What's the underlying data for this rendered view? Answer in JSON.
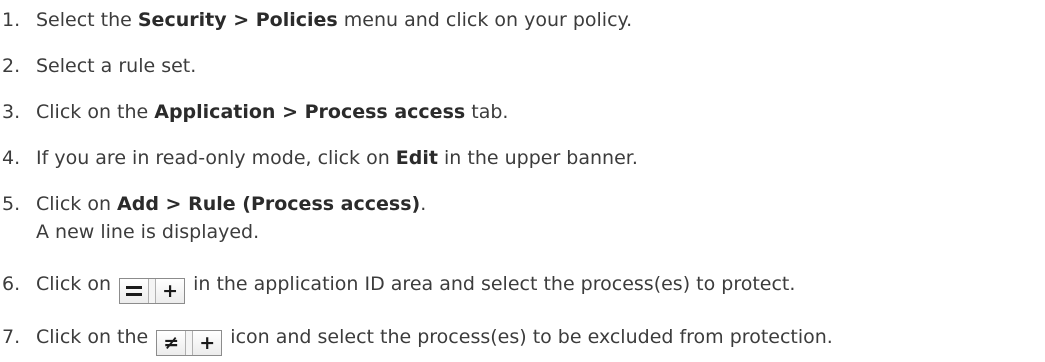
{
  "steps": [
    {
      "num": "1.",
      "pre": "Select the ",
      "b1": "Security",
      "mid": " > ",
      "b2": "Policies",
      "post": " menu and click on your policy."
    },
    {
      "num": "2.",
      "text": "Select a rule set."
    },
    {
      "num": "3.",
      "pre": "Click on the ",
      "b1": "Application",
      "mid": " > ",
      "b2": "Process access",
      "post": " tab."
    },
    {
      "num": "4.",
      "pre": "If you are in read-only mode, click on ",
      "b1": "Edit",
      "post": " in the upper banner."
    },
    {
      "num": "5.",
      "pre": "Click on ",
      "b1": "Add",
      "mid": " > ",
      "b2": "Rule (Process access)",
      "post": ".",
      "sub": "A new line is displayed."
    },
    {
      "num": "6.",
      "pre": "Click on",
      "icon": "equal-add-icon",
      "post": "in the application ID area and select the process(es) to protect."
    },
    {
      "num": "7.",
      "pre": "Click on the",
      "icon": "not-equal-add-icon",
      "icon_sym": "≠",
      "post": "icon and select the process(es) to be excluded from protection."
    }
  ],
  "icons": {
    "plus": "+"
  }
}
